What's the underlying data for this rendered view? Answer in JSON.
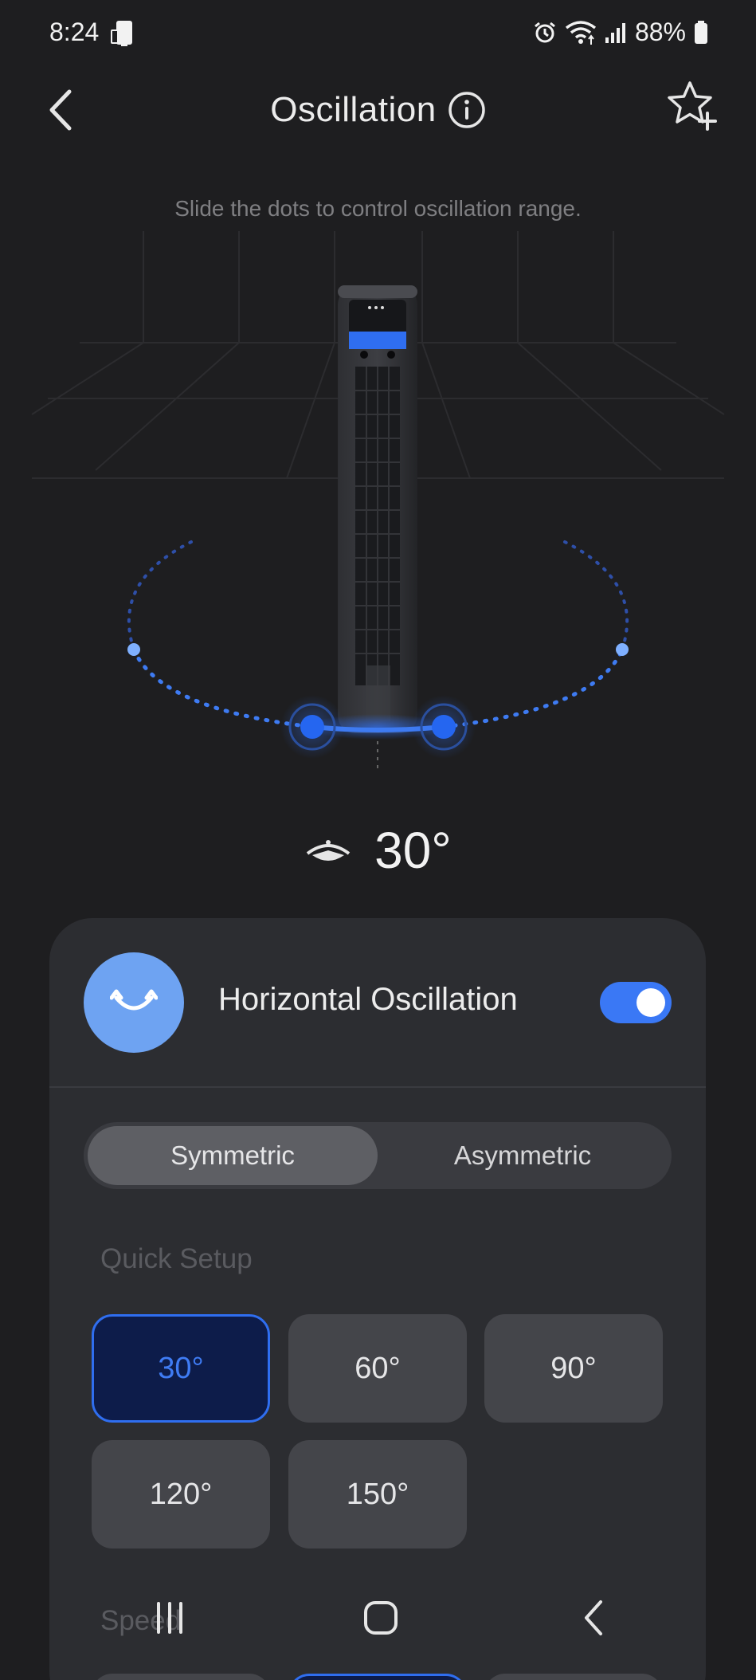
{
  "status_bar": {
    "time": "8:24",
    "battery": "88%"
  },
  "header": {
    "title": "Oscillation"
  },
  "hint": "Slide the dots to control oscillation range.",
  "current_angle": "30°",
  "card": {
    "oscillation_label": "Horizontal Oscillation",
    "oscillation_on": true,
    "mode_options": [
      "Symmetric",
      "Asymmetric"
    ],
    "selected_mode": "Symmetric",
    "quick_setup_title": "Quick Setup",
    "quick_setup": [
      "30°",
      "60°",
      "90°",
      "120°",
      "150°"
    ],
    "selected_quick": "30°",
    "speed_title": "Speed"
  },
  "colors": {
    "accent": "#3a78f5",
    "icon_circle": "#6ea3f2",
    "background": "#1e1e20",
    "card": "#2c2d31",
    "selected_bg": "#0d1c4a"
  }
}
